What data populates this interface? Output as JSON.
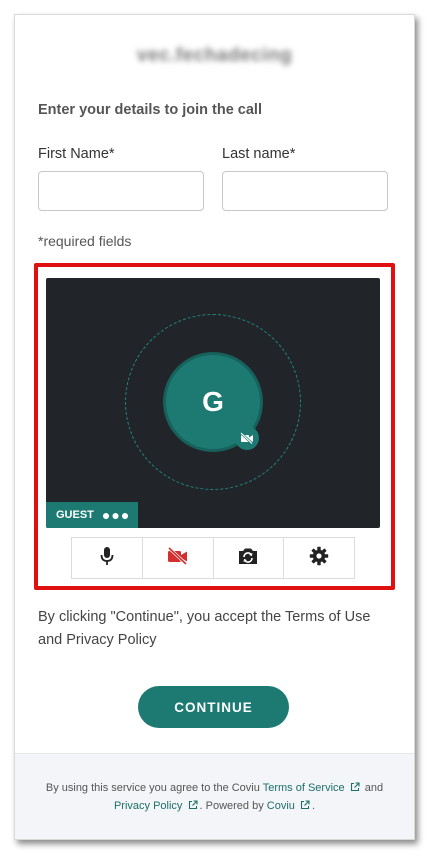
{
  "logo": {
    "text": "vec.fechadecing"
  },
  "form": {
    "heading": "Enter your details to join the call",
    "first_name_label": "First Name*",
    "last_name_label": "Last name*",
    "first_name_value": "",
    "last_name_value": "",
    "required_note": "*required fields"
  },
  "preview": {
    "avatar_initial": "G",
    "guest_label": "GUEST",
    "guest_menu_dots": "●●●",
    "camera_off": true
  },
  "controls": [
    {
      "icon": "microphone-icon"
    },
    {
      "icon": "camera-off-icon"
    },
    {
      "icon": "switch-camera-icon"
    },
    {
      "icon": "settings-gear-icon"
    }
  ],
  "terms_text": "By clicking \"Continue\", you accept the Terms of Use and Privacy Policy",
  "continue_label": "CONTINUE",
  "footer": {
    "prefix": "By using this service you agree to the Coviu",
    "terms_link": "Terms of Service",
    "and": "and",
    "privacy_link": "Privacy Policy",
    "powered_by": ". Powered by",
    "coviu_link": "Coviu",
    "end": "."
  },
  "colors": {
    "accent": "#1d7a73",
    "video_bg": "#212429",
    "highlight": "#e01010",
    "camera_off_red": "#d32f2f"
  }
}
